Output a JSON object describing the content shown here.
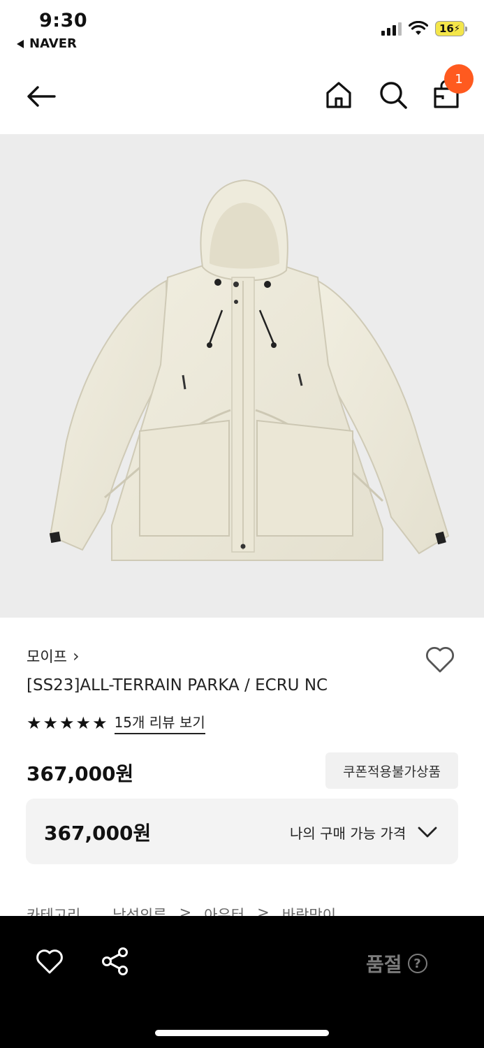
{
  "status_bar": {
    "time": "9:30",
    "back_app": "NAVER",
    "battery": "16"
  },
  "nav": {
    "cart_count": "1"
  },
  "product": {
    "brand": "모이프",
    "brand_chevron": "›",
    "title": "[SS23]ALL-TERRAIN PARKA / ECRU NC",
    "rating_stars": 5,
    "review_link": "15개 리뷰 보기",
    "price": "367,000원",
    "coupon_chip": "쿠폰적용불가상품",
    "my_price": "367,000원",
    "my_price_label": "나의 구매 가능 가격",
    "category_label": "카테고리",
    "category_path": [
      "남성의류",
      "아우터",
      "바람막이"
    ],
    "category_sep": ">"
  },
  "bottom_bar": {
    "soldout_label": "품절",
    "help_glyph": "?"
  },
  "icons": {
    "back": "arrow-left-icon",
    "home": "home-icon",
    "search": "search-icon",
    "cart": "shopping-bag-icon",
    "wish": "heart-outline-icon",
    "share": "share-icon",
    "dropdown": "chevron-down-icon"
  },
  "colors": {
    "badge": "#ff5a1f",
    "image_bg": "#ececec",
    "bottom_bar": "#000000",
    "soldout_text": "#7b7b7b"
  }
}
